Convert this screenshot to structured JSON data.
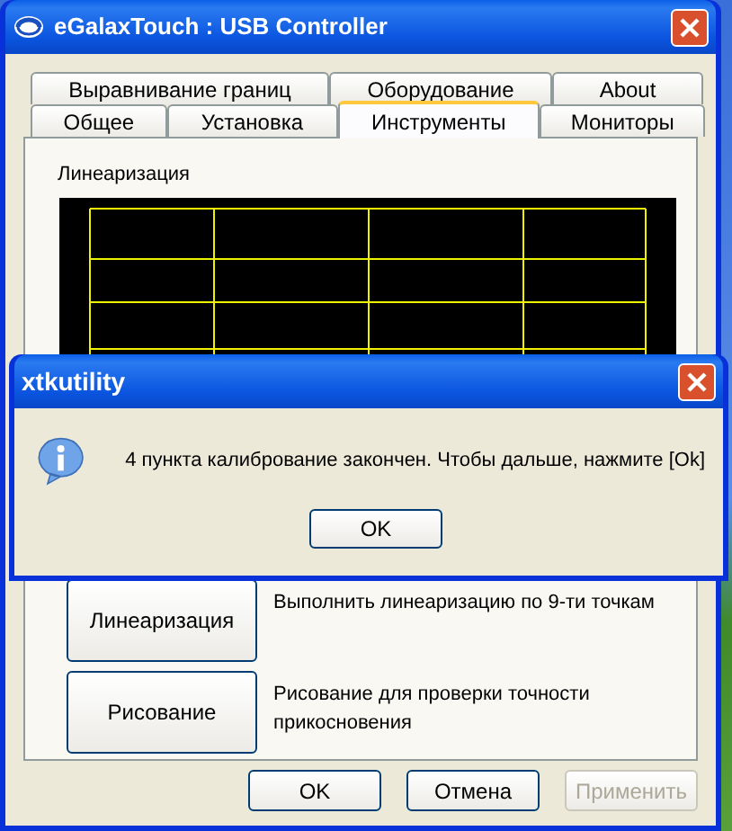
{
  "window": {
    "title": "eGalaxTouch : USB Controller"
  },
  "tab_rows": [
    [
      {
        "label": "Выравнивание границ",
        "selected": false
      },
      {
        "label": "Оборудование",
        "selected": false
      },
      {
        "label": "About",
        "selected": false
      }
    ],
    [
      {
        "label": "Общее",
        "selected": false
      },
      {
        "label": "Установка",
        "selected": false
      },
      {
        "label": "Инструменты",
        "selected": true
      },
      {
        "label": "Мониторы",
        "selected": false
      }
    ]
  ],
  "panel": {
    "label": "Линеаризация",
    "tools": [
      {
        "button": "Линеаризация",
        "description": "Выполнить линеаризацию по 9-ти точкам"
      },
      {
        "button": "Рисование",
        "description": "Рисование для проверки точности прикосновения"
      }
    ]
  },
  "buttons": [
    {
      "label": "OK",
      "disabled": false
    },
    {
      "label": "Отмена",
      "disabled": false
    },
    {
      "label": "Применить",
      "disabled": true
    }
  ],
  "dialog": {
    "title": "xtkutility",
    "message": "4 пункта калибрование закончен. Чтобы дальше, нажмите [Ok]",
    "button": "OK"
  }
}
